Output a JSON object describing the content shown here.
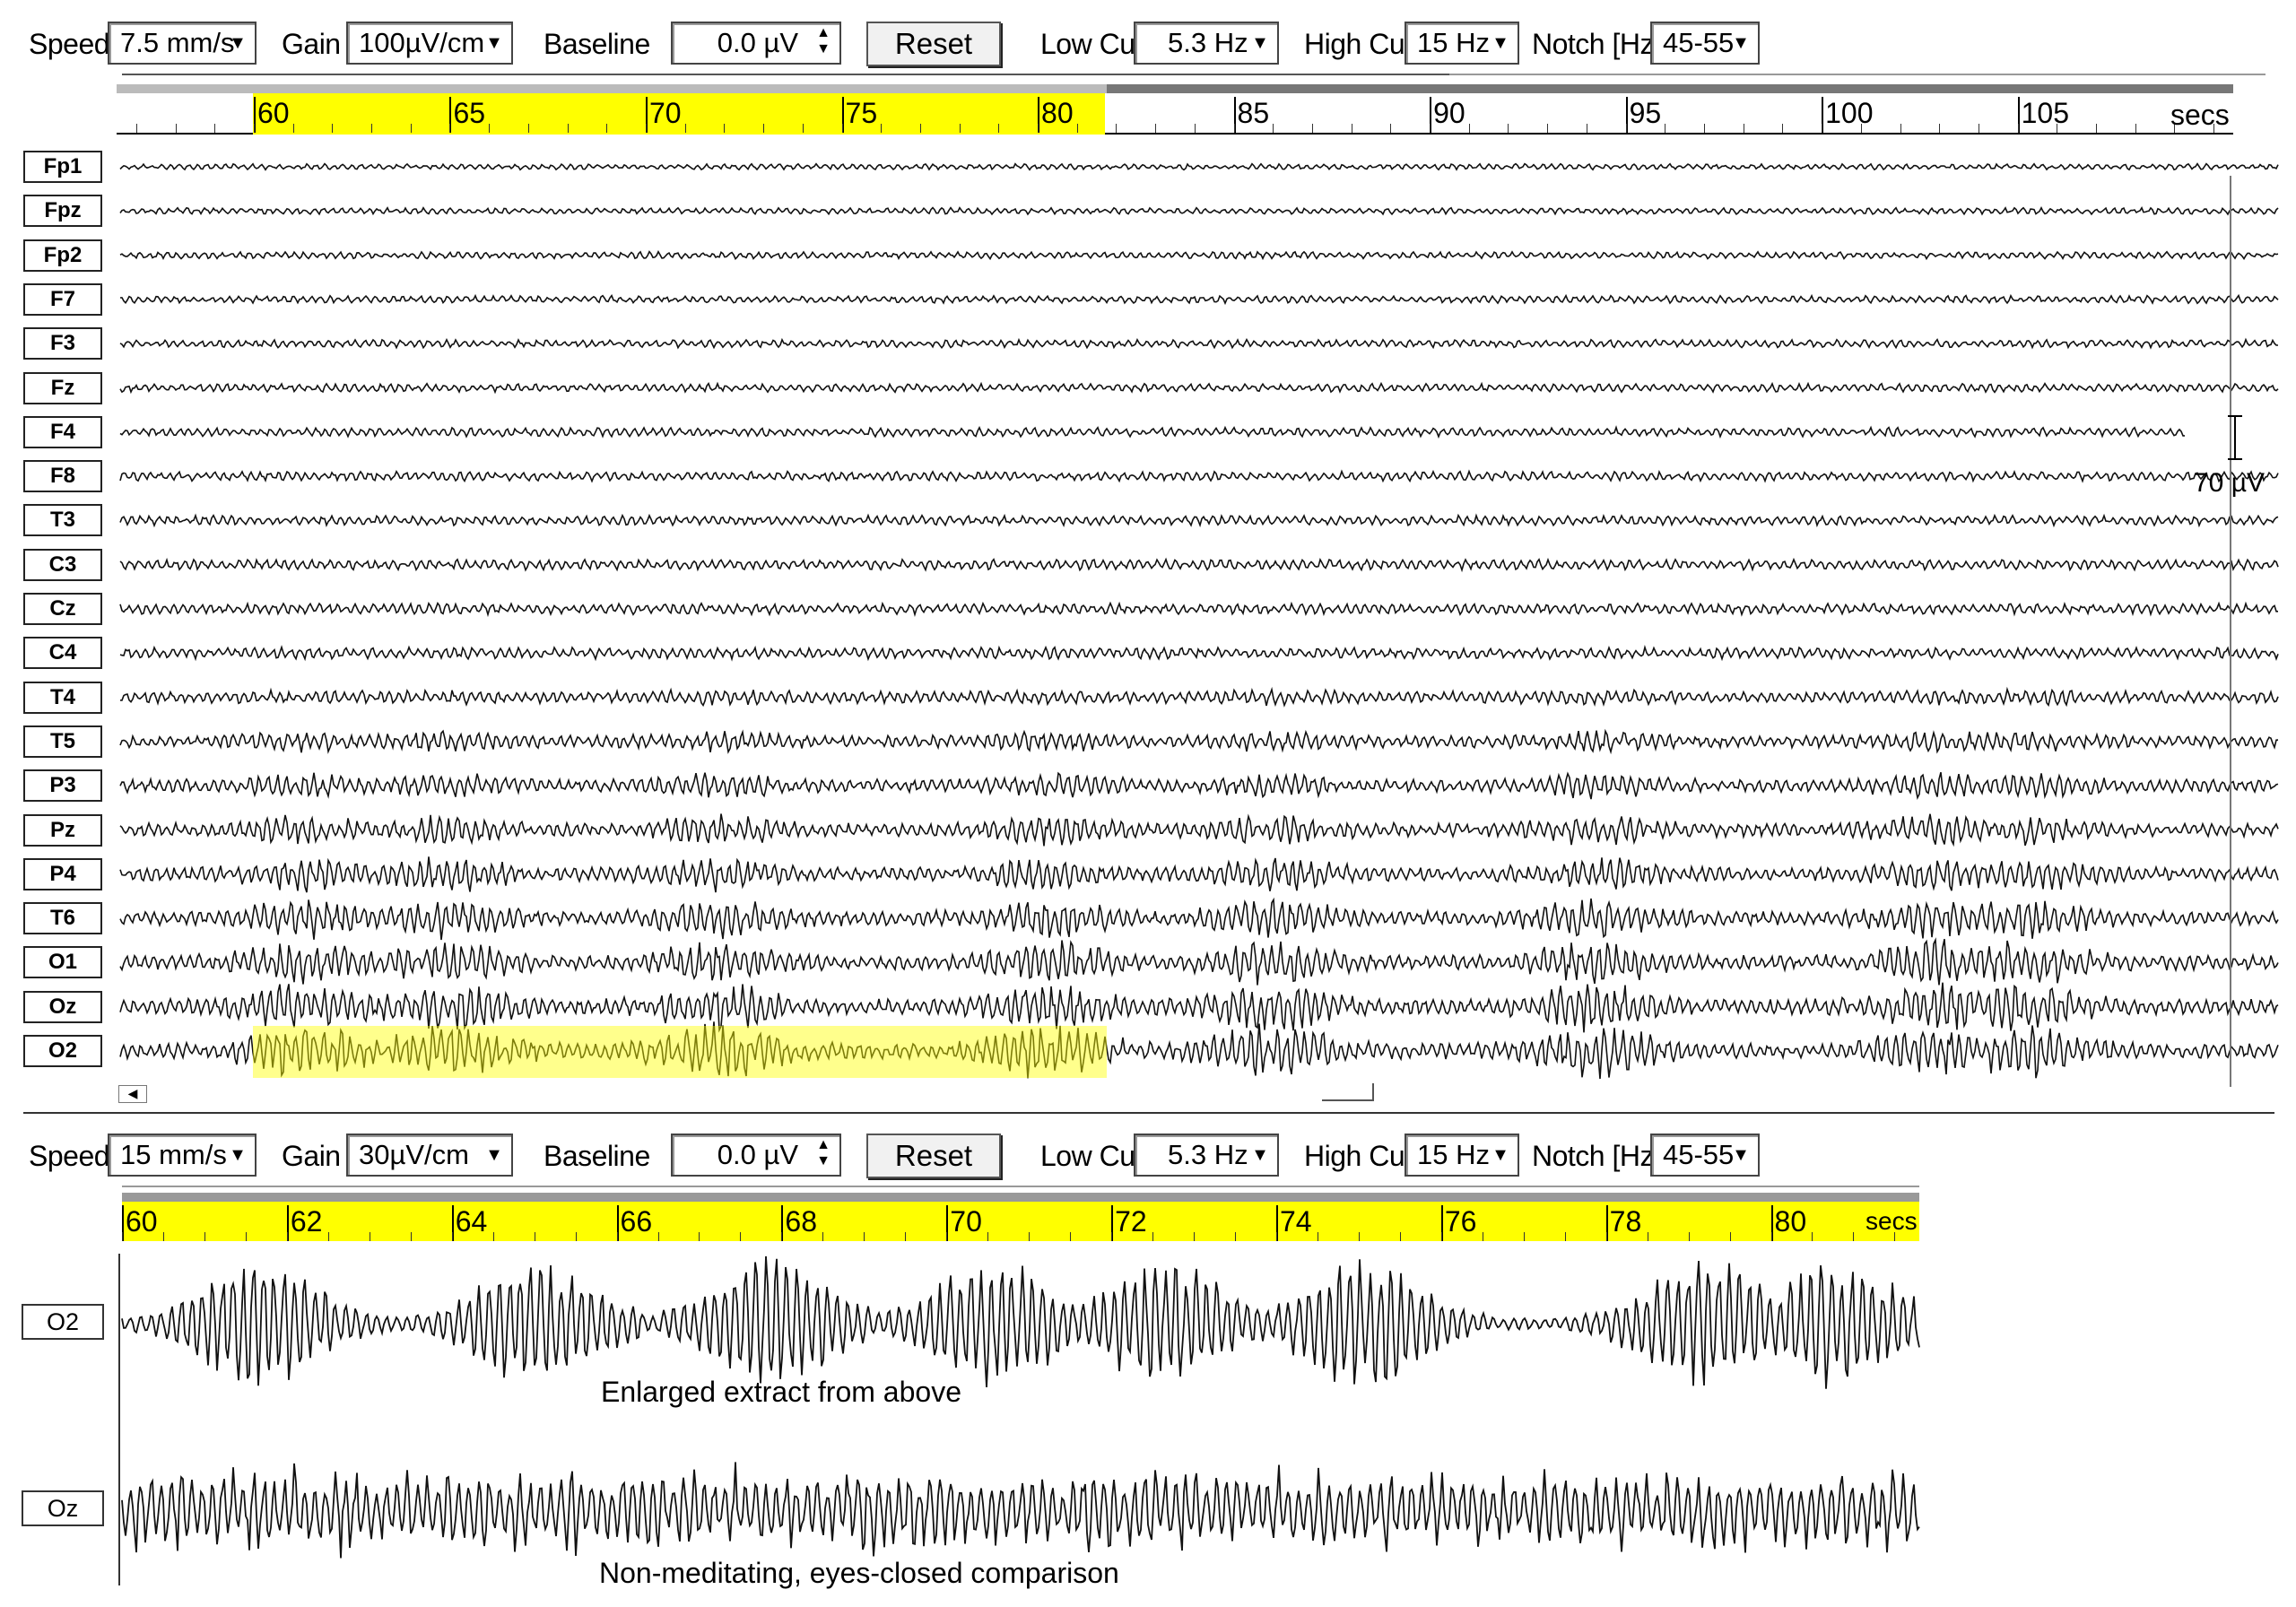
{
  "toolbar_top": {
    "speed_label": "Speed",
    "speed_value": "7.5 mm/s",
    "gain_label": "Gain",
    "gain_value": "100µV/cm",
    "baseline_label": "Baseline",
    "baseline_value": "0.0 µV",
    "reset_label": "Reset",
    "lowcut_label": "Low Cut",
    "lowcut_value": "5.3 Hz",
    "highcut_label": "High Cut",
    "highcut_value": "15 Hz",
    "notch_label": "Notch [Hz]",
    "notch_value": "45-55"
  },
  "ruler_top": {
    "ticks": [
      "60",
      "65",
      "70",
      "75",
      "80",
      "85",
      "90",
      "95",
      "100",
      "105"
    ],
    "unit": "secs",
    "highlight_range": [
      60,
      82.5
    ],
    "view_range": [
      56.5,
      110.5
    ]
  },
  "channels": [
    "Fp1",
    "Fpz",
    "Fp2",
    "F7",
    "F3",
    "Fz",
    "F4",
    "F8",
    "T3",
    "C3",
    "Cz",
    "C4",
    "T4",
    "T5",
    "P3",
    "Pz",
    "P4",
    "T6",
    "O1",
    "Oz",
    "O2"
  ],
  "scale_bar": {
    "label": "70 µV"
  },
  "toolbar_bottom": {
    "speed_label": "Speed",
    "speed_value": "15 mm/s",
    "gain_label": "Gain",
    "gain_value": "30µV/cm",
    "baseline_label": "Baseline",
    "baseline_value": "0.0 µV",
    "reset_label": "Reset",
    "lowcut_label": "Low Cut",
    "lowcut_value": "5.3 Hz",
    "highcut_label": "High Cut",
    "highcut_value": "15 Hz",
    "notch_label": "Notch [Hz]",
    "notch_value": "45-55"
  },
  "ruler_bottom": {
    "ticks": [
      "60",
      "62",
      "64",
      "66",
      "68",
      "70",
      "72",
      "74",
      "76",
      "78",
      "80"
    ],
    "unit": "secs",
    "view_range": [
      60,
      81.8
    ]
  },
  "extract": {
    "channel_1": "O2",
    "caption_1": "Enlarged extract from above",
    "channel_2": "Oz",
    "caption_2": "Non-meditating, eyes-closed comparison"
  },
  "colors": {
    "highlight": "#ffff00",
    "trace": "#111111"
  }
}
